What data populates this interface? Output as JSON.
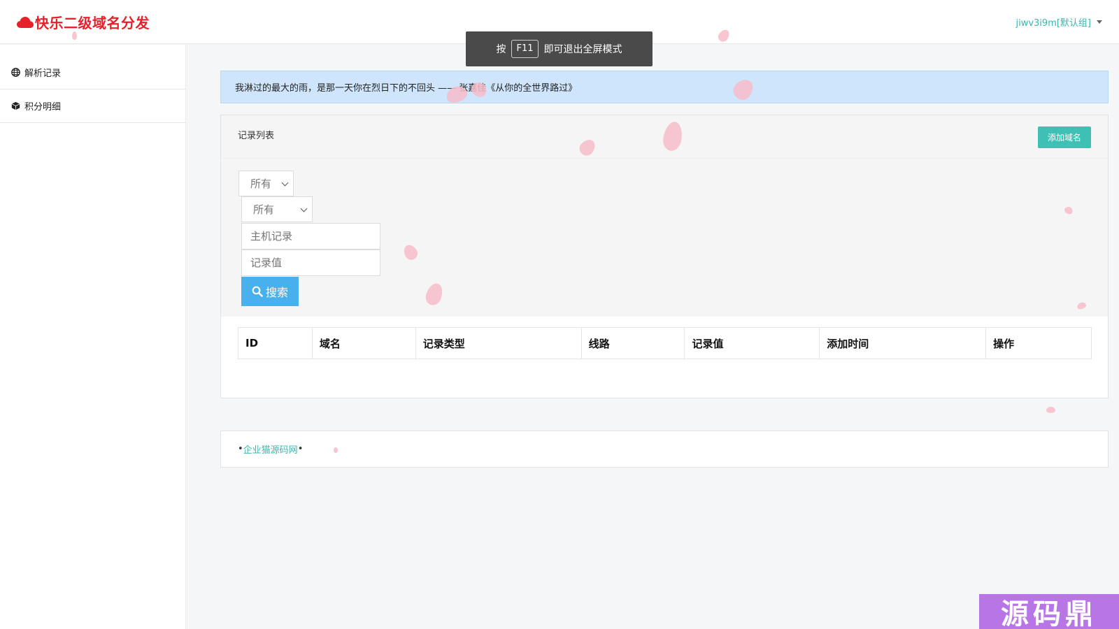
{
  "header": {
    "brand_title": "快乐二级域名分发",
    "user_label": "jiwv3i9m[默认组]",
    "brand_color": "#e8202a",
    "accent_color": "#3cb4b0"
  },
  "toast": {
    "prefix": "按",
    "key": "F11",
    "suffix": "即可退出全屏模式"
  },
  "sidebar": {
    "items": [
      {
        "label": "解析记录",
        "icon": "globe-icon"
      },
      {
        "label": "积分明细",
        "icon": "cube-icon"
      }
    ]
  },
  "alert": {
    "quote": "我淋过的最大的雨，是那一天你在烈日下的不回头 —— 张嘉佳《从你的全世界路过》"
  },
  "panel": {
    "title": "记录列表",
    "add_button": "添加域名",
    "filters": {
      "select_1": "所有",
      "select_2": "所有",
      "host_placeholder": "主机记录",
      "value_placeholder": "记录值",
      "search_button": "搜索"
    },
    "table": {
      "columns": [
        "ID",
        "域名",
        "记录类型",
        "线路",
        "记录值",
        "添加时间",
        "操作"
      ],
      "rows": []
    }
  },
  "footer": {
    "link_text": "企业猫源码网"
  },
  "watermark": {
    "text": "源码鼎"
  }
}
